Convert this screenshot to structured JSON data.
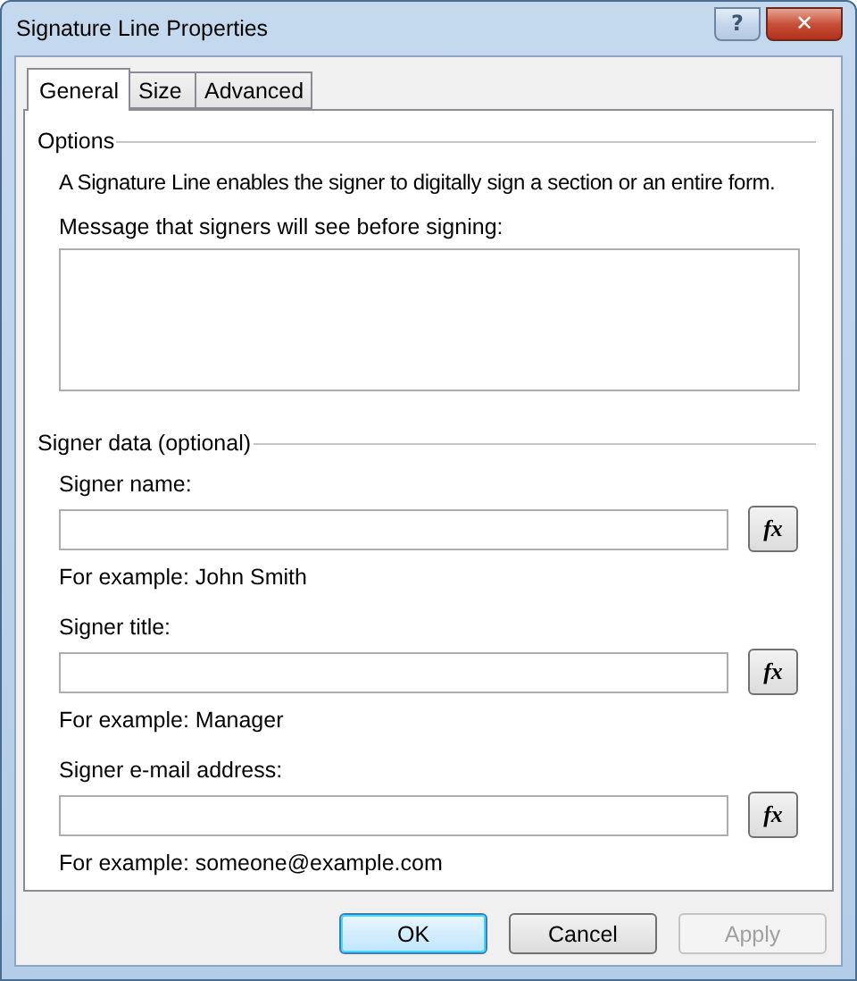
{
  "window": {
    "title": "Signature Line Properties",
    "help_button": "?",
    "close_button": "✕"
  },
  "tabs": [
    {
      "label": "General",
      "selected": true
    },
    {
      "label": "Size",
      "selected": false
    },
    {
      "label": "Advanced",
      "selected": false
    }
  ],
  "options": {
    "heading": "Options",
    "description": "A Signature Line enables the signer to digitally sign a section or an entire form.",
    "message_label": "Message that signers will see before signing:"
  },
  "signer_data": {
    "heading": "Signer data (optional)",
    "fields": [
      {
        "label": "Signer name:",
        "button": "fx",
        "example": "For example: John Smith"
      },
      {
        "label": "Signer title:",
        "button": "fx",
        "example": "For example: Manager"
      },
      {
        "label": "Signer e-mail address:",
        "button": "fx",
        "example": "For example: someone@example.com"
      }
    ]
  },
  "buttons": [
    {
      "label": "OK",
      "default": true,
      "disabled": false
    },
    {
      "label": "Cancel",
      "default": false,
      "disabled": false
    },
    {
      "label": "Apply",
      "default": false,
      "disabled": true
    }
  ]
}
